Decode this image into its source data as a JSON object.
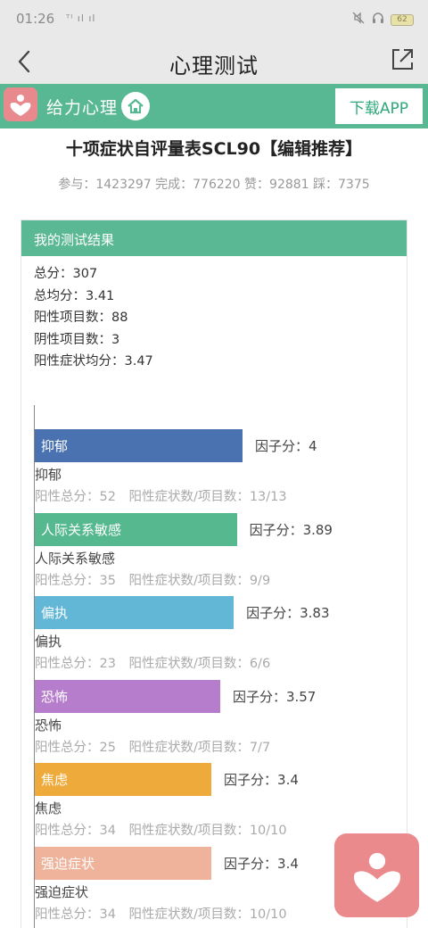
{
  "status_bar": {
    "time": "01:26",
    "signal_text": "ᵀᴵ ıl ıl",
    "battery": "62"
  },
  "nav": {
    "title": "心理测试"
  },
  "banner": {
    "brand": "给力心理",
    "download_label": "下载APP"
  },
  "test": {
    "title": "十项症状自评量表SCL90【编辑推荐】",
    "stats": "参与：1423297 完成：776220 赞：92881 踩：7375"
  },
  "result": {
    "header": "我的测试结果",
    "summary": [
      "总分：307",
      "总均分：3.41",
      "阳性项目数：88",
      "阴性项目数：3",
      "阳性症状均分：3.47"
    ]
  },
  "chart_data": {
    "type": "bar",
    "orientation": "horizontal",
    "categories": [
      "抑郁",
      "人际关系敏感",
      "偏执",
      "恐怖",
      "焦虑",
      "强迫症状"
    ],
    "values": [
      4,
      3.89,
      3.83,
      3.57,
      3.4,
      3.4
    ],
    "factor_labels": [
      "因子分：4",
      "因子分：3.89",
      "因子分：3.83",
      "因子分：3.57",
      "因子分：3.4",
      "因子分：3.4"
    ],
    "details": [
      "阳性总分：52　阳性症状数/项目数：13/13",
      "阳性总分：35　阳性症状数/项目数：9/9",
      "阳性总分：23　阳性症状数/项目数：6/6",
      "阳性总分：25　阳性症状数/项目数：7/7",
      "阳性总分：34　阳性症状数/项目数：10/10",
      "阳性总分：34　阳性症状数/项目数：10/10"
    ],
    "colors": [
      "#4a72b0",
      "#55b88e",
      "#62b6d6",
      "#b57dcb",
      "#eeaa3a",
      "#eeb39a"
    ],
    "xlim": [
      0,
      4.43
    ]
  }
}
